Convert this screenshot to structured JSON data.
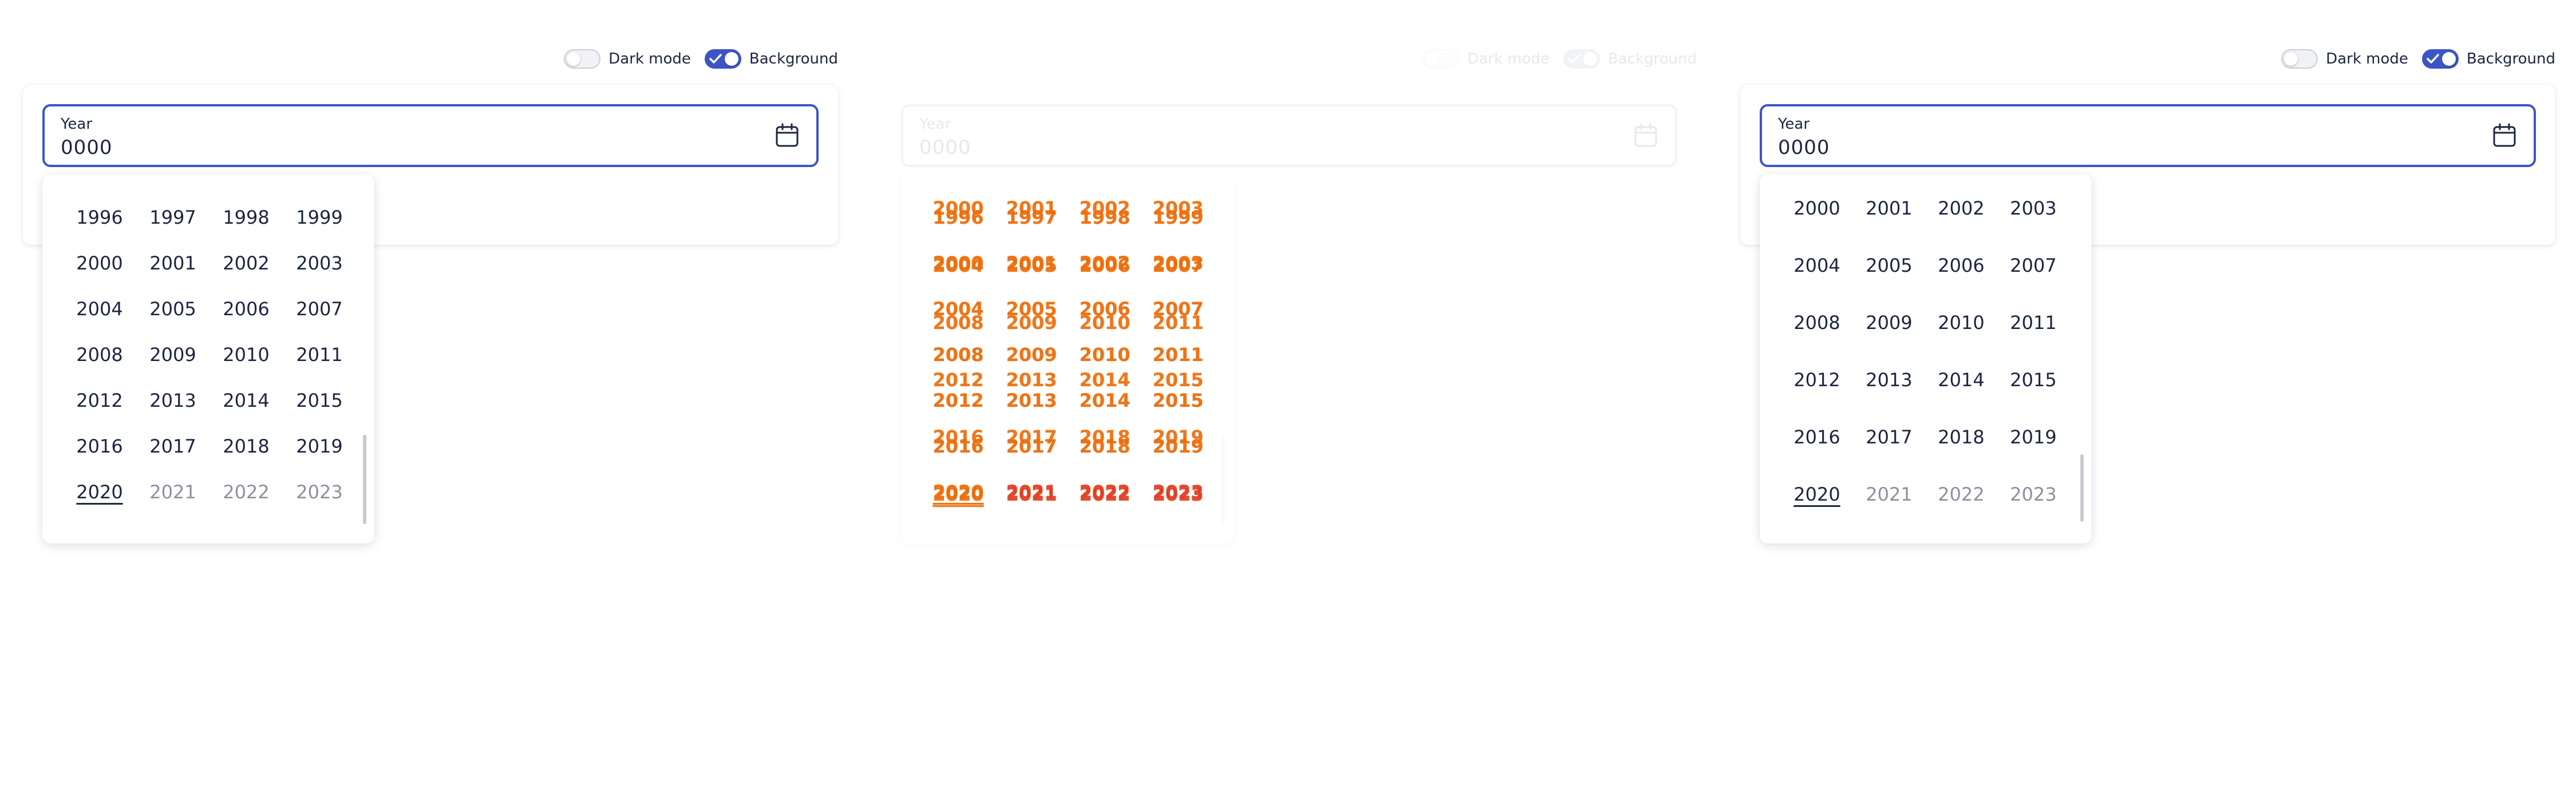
{
  "controls": {
    "dark_mode_label": "Dark mode",
    "background_label": "Background"
  },
  "field": {
    "label": "Year",
    "value": "0000"
  },
  "years_view_a": [
    [
      "1996",
      "1997",
      "1998",
      "1999"
    ],
    [
      "2000",
      "2001",
      "2002",
      "2003"
    ],
    [
      "2004",
      "2005",
      "2006",
      "2007"
    ],
    [
      "2008",
      "2009",
      "2010",
      "2011"
    ],
    [
      "2012",
      "2013",
      "2014",
      "2015"
    ],
    [
      "2016",
      "2017",
      "2018",
      "2019"
    ],
    [
      "2020",
      "2021",
      "2022",
      "2023"
    ]
  ],
  "years_view_b": [
    [
      "2000",
      "2001",
      "2002",
      "2003"
    ],
    [
      "2004",
      "2005",
      "2006",
      "2007"
    ],
    [
      "2008",
      "2009",
      "2010",
      "2011"
    ],
    [
      "2012",
      "2013",
      "2014",
      "2015"
    ],
    [
      "2016",
      "2017",
      "2018",
      "2019"
    ],
    [
      "2020",
      "2021",
      "2022",
      "2023"
    ]
  ],
  "current_year": "2020",
  "disabled_years": [
    "2021",
    "2022",
    "2023"
  ],
  "colors": {
    "accent": "#3d55c4",
    "text": "#1c2540",
    "muted": "#8b91a0",
    "ghost_orange": "#ec6c0e",
    "ghost_red": "#e23c2a"
  },
  "icons": {
    "calendar": "calendar-icon",
    "check": "check-icon"
  }
}
